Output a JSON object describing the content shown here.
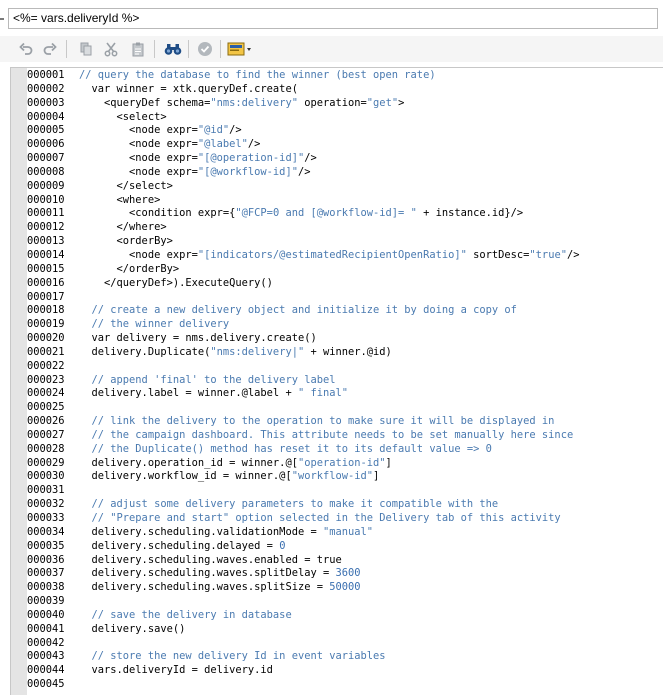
{
  "field": {
    "value": "<%= vars.deliveryId %>"
  },
  "toolbar": {
    "icons": [
      "undo-icon",
      "redo-icon",
      "copy-icon",
      "cut-icon",
      "paste-icon",
      "find-icon",
      "validate-icon",
      "insert-field-icon"
    ]
  },
  "editor": {
    "lines": [
      {
        "n": "000001",
        "segs": [
          {
            "t": "// query the database to find the winner (best open rate)",
            "c": "cmt"
          }
        ]
      },
      {
        "n": "000002",
        "segs": [
          {
            "t": "  var winner = xtk.queryDef.create(",
            "c": ""
          }
        ]
      },
      {
        "n": "000003",
        "segs": [
          {
            "t": "    <queryDef schema=",
            "c": ""
          },
          {
            "t": "\"nms:delivery\"",
            "c": "str"
          },
          {
            "t": " operation=",
            "c": ""
          },
          {
            "t": "\"get\"",
            "c": "str"
          },
          {
            "t": ">",
            "c": ""
          }
        ]
      },
      {
        "n": "000004",
        "segs": [
          {
            "t": "      <select>",
            "c": ""
          }
        ]
      },
      {
        "n": "000005",
        "segs": [
          {
            "t": "        <node expr=",
            "c": ""
          },
          {
            "t": "\"@id\"",
            "c": "str"
          },
          {
            "t": "/>",
            "c": ""
          }
        ]
      },
      {
        "n": "000006",
        "segs": [
          {
            "t": "        <node expr=",
            "c": ""
          },
          {
            "t": "\"@label\"",
            "c": "str"
          },
          {
            "t": "/>",
            "c": ""
          }
        ]
      },
      {
        "n": "000007",
        "segs": [
          {
            "t": "        <node expr=",
            "c": ""
          },
          {
            "t": "\"[@operation-id]\"",
            "c": "str"
          },
          {
            "t": "/>",
            "c": ""
          }
        ]
      },
      {
        "n": "000008",
        "segs": [
          {
            "t": "        <node expr=",
            "c": ""
          },
          {
            "t": "\"[@workflow-id]\"",
            "c": "str"
          },
          {
            "t": "/>",
            "c": ""
          }
        ]
      },
      {
        "n": "000009",
        "segs": [
          {
            "t": "      </select>",
            "c": ""
          }
        ]
      },
      {
        "n": "000010",
        "segs": [
          {
            "t": "      <where>",
            "c": ""
          }
        ]
      },
      {
        "n": "000011",
        "segs": [
          {
            "t": "        <condition expr={",
            "c": ""
          },
          {
            "t": "\"@FCP=0 and [@workflow-id]= \"",
            "c": "str"
          },
          {
            "t": " + instance.id}/>",
            "c": ""
          }
        ]
      },
      {
        "n": "000012",
        "segs": [
          {
            "t": "      </where>",
            "c": ""
          }
        ]
      },
      {
        "n": "000013",
        "segs": [
          {
            "t": "      <orderBy>",
            "c": ""
          }
        ]
      },
      {
        "n": "000014",
        "segs": [
          {
            "t": "        <node expr=",
            "c": ""
          },
          {
            "t": "\"[indicators/@estimatedRecipientOpenRatio]\"",
            "c": "str"
          },
          {
            "t": " sortDesc=",
            "c": ""
          },
          {
            "t": "\"true\"",
            "c": "str"
          },
          {
            "t": "/>",
            "c": ""
          }
        ]
      },
      {
        "n": "000015",
        "segs": [
          {
            "t": "      </orderBy>",
            "c": ""
          }
        ]
      },
      {
        "n": "000016",
        "segs": [
          {
            "t": "    </queryDef>).ExecuteQuery()",
            "c": ""
          }
        ]
      },
      {
        "n": "000017",
        "segs": []
      },
      {
        "n": "000018",
        "segs": [
          {
            "t": "  // create a new delivery object and initialize it by doing a copy of",
            "c": "cmt"
          }
        ]
      },
      {
        "n": "000019",
        "segs": [
          {
            "t": "  // the winner delivery",
            "c": "cmt"
          }
        ]
      },
      {
        "n": "000020",
        "segs": [
          {
            "t": "  var delivery = nms.delivery.create()",
            "c": ""
          }
        ]
      },
      {
        "n": "000021",
        "segs": [
          {
            "t": "  delivery.Duplicate(",
            "c": ""
          },
          {
            "t": "\"nms:delivery|\"",
            "c": "str"
          },
          {
            "t": " + winner.@id)",
            "c": ""
          }
        ]
      },
      {
        "n": "000022",
        "segs": []
      },
      {
        "n": "000023",
        "segs": [
          {
            "t": "  // append 'final' to the delivery label",
            "c": "cmt"
          }
        ]
      },
      {
        "n": "000024",
        "segs": [
          {
            "t": "  delivery.label = winner.@label + ",
            "c": ""
          },
          {
            "t": "\" final\"",
            "c": "str"
          }
        ]
      },
      {
        "n": "000025",
        "segs": []
      },
      {
        "n": "000026",
        "segs": [
          {
            "t": "  // link the delivery to the operation to make sure it will be displayed in",
            "c": "cmt"
          }
        ]
      },
      {
        "n": "000027",
        "segs": [
          {
            "t": "  // the campaign dashboard. This attribute needs to be set manually here since",
            "c": "cmt"
          }
        ]
      },
      {
        "n": "000028",
        "segs": [
          {
            "t": "  // the Duplicate() method has reset it to its default value => 0",
            "c": "cmt"
          }
        ]
      },
      {
        "n": "000029",
        "segs": [
          {
            "t": "  delivery.operation_id = winner.@[",
            "c": ""
          },
          {
            "t": "\"operation-id\"",
            "c": "str"
          },
          {
            "t": "]",
            "c": ""
          }
        ]
      },
      {
        "n": "000030",
        "segs": [
          {
            "t": "  delivery.workflow_id = winner.@[",
            "c": ""
          },
          {
            "t": "\"workflow-id\"",
            "c": "str"
          },
          {
            "t": "]",
            "c": ""
          }
        ]
      },
      {
        "n": "000031",
        "segs": []
      },
      {
        "n": "000032",
        "segs": [
          {
            "t": "  // adjust some delivery parameters to make it compatible with the",
            "c": "cmt"
          }
        ]
      },
      {
        "n": "000033",
        "segs": [
          {
            "t": "  // \"Prepare and start\" option selected in the Delivery tab of this activity",
            "c": "cmt"
          }
        ]
      },
      {
        "n": "000034",
        "segs": [
          {
            "t": "  delivery.scheduling.validationMode = ",
            "c": ""
          },
          {
            "t": "\"manual\"",
            "c": "str"
          }
        ]
      },
      {
        "n": "000035",
        "segs": [
          {
            "t": "  delivery.scheduling.delayed = ",
            "c": ""
          },
          {
            "t": "0",
            "c": "num"
          }
        ]
      },
      {
        "n": "000036",
        "segs": [
          {
            "t": "  delivery.scheduling.waves.enabled = true",
            "c": ""
          }
        ]
      },
      {
        "n": "000037",
        "segs": [
          {
            "t": "  delivery.scheduling.waves.splitDelay = ",
            "c": ""
          },
          {
            "t": "3600",
            "c": "num"
          }
        ]
      },
      {
        "n": "000038",
        "segs": [
          {
            "t": "  delivery.scheduling.waves.splitSize = ",
            "c": ""
          },
          {
            "t": "50000",
            "c": "num"
          }
        ]
      },
      {
        "n": "000039",
        "segs": []
      },
      {
        "n": "000040",
        "segs": [
          {
            "t": "  // save the delivery in database",
            "c": "cmt"
          }
        ]
      },
      {
        "n": "000041",
        "segs": [
          {
            "t": "  delivery.save()",
            "c": ""
          }
        ]
      },
      {
        "n": "000042",
        "segs": []
      },
      {
        "n": "000043",
        "segs": [
          {
            "t": "  // store the new delivery Id in event variables",
            "c": "cmt"
          }
        ]
      },
      {
        "n": "000044",
        "segs": [
          {
            "t": "  vars.deliveryId = delivery.id",
            "c": ""
          }
        ]
      },
      {
        "n": "000045",
        "segs": []
      }
    ]
  }
}
